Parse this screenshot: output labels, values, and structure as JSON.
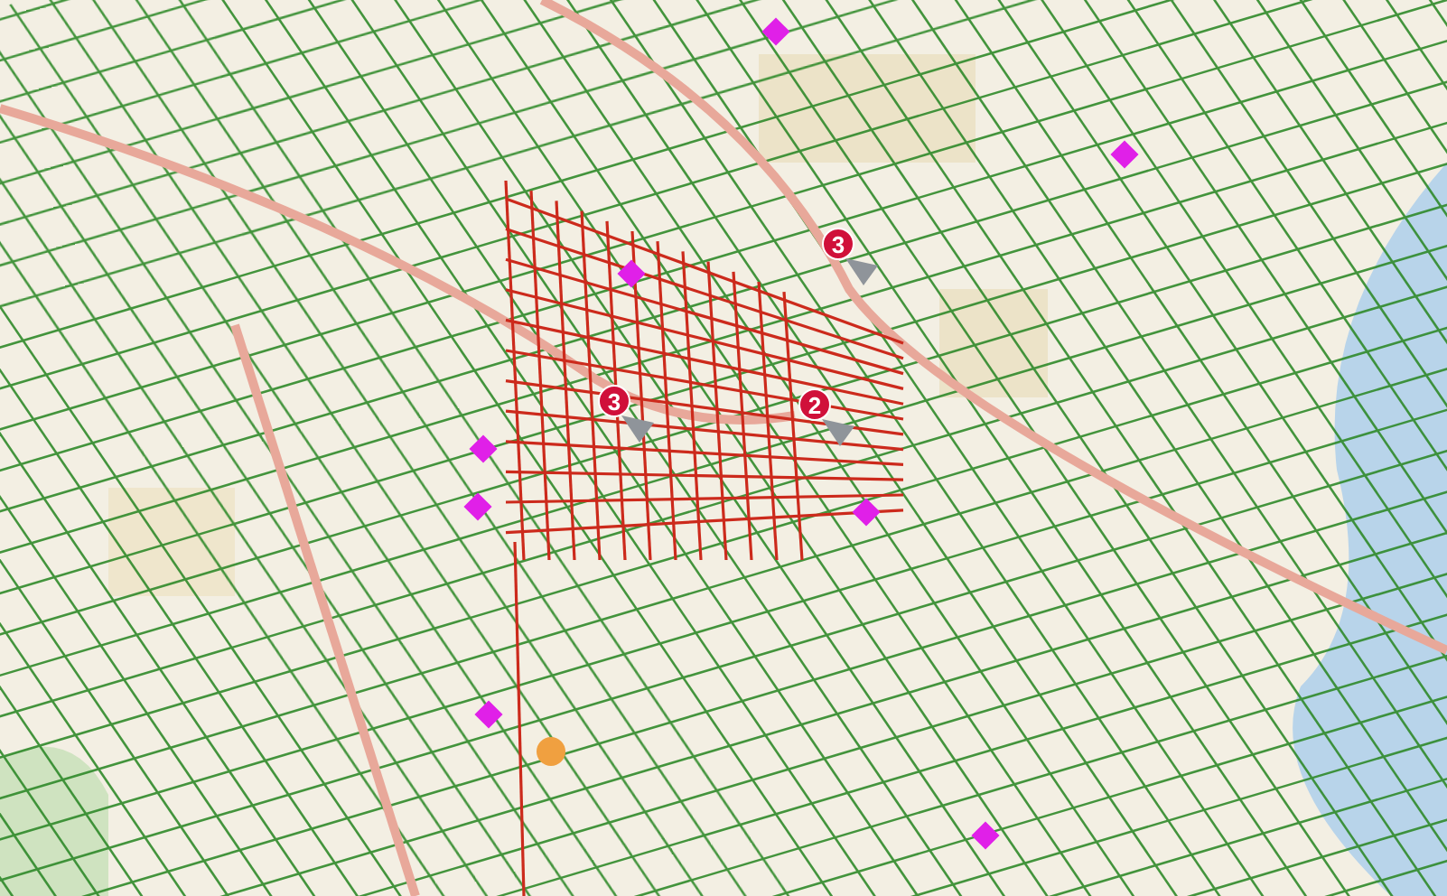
{
  "map": {
    "clusters": [
      {
        "count": "3"
      },
      {
        "count": "3"
      },
      {
        "count": "2"
      }
    ],
    "markers": [
      {
        "kind": "diamond",
        "color": "#e020e8"
      },
      {
        "kind": "diamond",
        "color": "#e020e8"
      },
      {
        "kind": "diamond",
        "color": "#e020e8"
      },
      {
        "kind": "diamond",
        "color": "#e020e8"
      },
      {
        "kind": "diamond",
        "color": "#e020e8"
      },
      {
        "kind": "diamond",
        "color": "#e020e8"
      },
      {
        "kind": "diamond",
        "color": "#e020e8"
      },
      {
        "kind": "diamond",
        "color": "#e020e8"
      },
      {
        "kind": "circle",
        "color": "#f0a040"
      }
    ]
  }
}
